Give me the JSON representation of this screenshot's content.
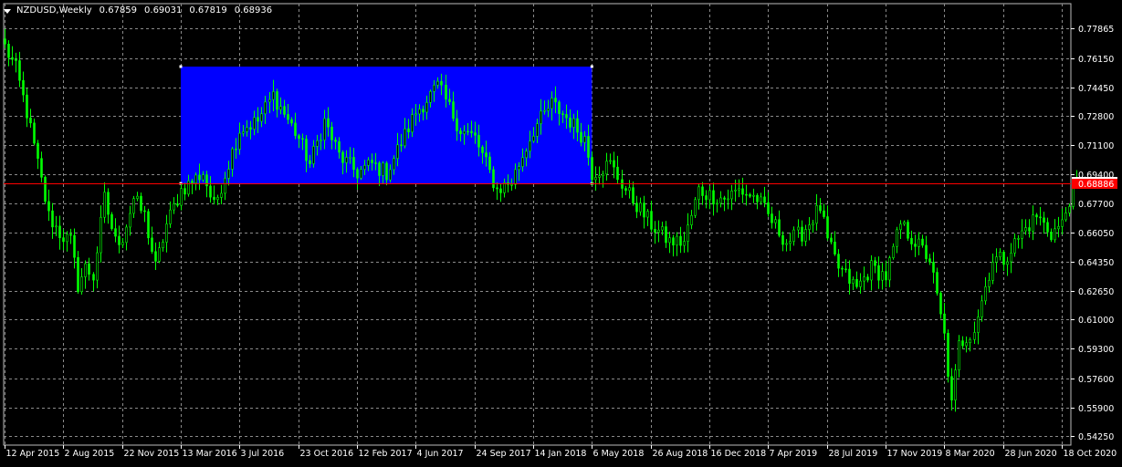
{
  "window": {
    "symbol_label": "NZDUSD,Weekly",
    "ohlc": [
      "0.67859",
      "0.69031",
      "0.67819",
      "0.68936"
    ]
  },
  "colors": {
    "background": "#000000",
    "grid": "#8a8a8a",
    "candle": "#00ff00",
    "rectangle": "#0000ff",
    "hline": "#ff0000",
    "price_tag_bg": "#ffffff",
    "hline_tag_bg": "#ff0000"
  },
  "chart_data": {
    "type": "candlestick",
    "title": "NZDUSD,Weekly",
    "ylim": [
      0.5425,
      0.7845
    ],
    "y_ticks": [
      "0.77865",
      "0.76150",
      "0.74450",
      "0.72800",
      "0.71100",
      "0.69400",
      "0.67700",
      "0.66050",
      "0.64350",
      "0.62650",
      "0.61000",
      "0.59300",
      "0.57600",
      "0.55900",
      "0.54250"
    ],
    "x_labels": [
      "12 Apr 2015",
      "2 Aug 2015",
      "22 Nov 2015",
      "13 Mar 2016",
      "3 Jul 2016",
      "23 Oct 2016",
      "12 Feb 2017",
      "4 Jun 2017",
      "24 Sep 2017",
      "14 Jan 2018",
      "6 May 2018",
      "26 Aug 2018",
      "16 Dec 2018",
      "7 Apr 2019",
      "28 Jul 2019",
      "17 Nov 2019",
      "8 Mar 2020",
      "28 Jun 2020",
      "18 Oct 2020"
    ],
    "current_price": "0.68936",
    "horizontal_line_price": "0.68886",
    "rectangle": {
      "from": "13 Mar 2016",
      "to": "6 May 2018",
      "top": 0.7565,
      "bottom": 0.6888
    },
    "path_anchors": [
      [
        "12 Apr 2015",
        0.768
      ],
      [
        "3 May 2015",
        0.755
      ],
      [
        "24 May 2015",
        0.73
      ],
      [
        "14 Jun 2015",
        0.7
      ],
      [
        "5 Jul 2015",
        0.67
      ],
      [
        "26 Jul 2015",
        0.66
      ],
      [
        "2 Aug 2015",
        0.658
      ],
      [
        "16 Aug 2015",
        0.655
      ],
      [
        "30 Aug 2015",
        0.63
      ],
      [
        "13 Sep 2015",
        0.64
      ],
      [
        "27 Sep 2015",
        0.635
      ],
      [
        "18 Oct 2015",
        0.68
      ],
      [
        "8 Nov 2015",
        0.655
      ],
      [
        "22 Nov 2015",
        0.658
      ],
      [
        "13 Dec 2015",
        0.68
      ],
      [
        "3 Jan 2016",
        0.67
      ],
      [
        "24 Jan 2016",
        0.64
      ],
      [
        "14 Feb 2016",
        0.665
      ],
      [
        "6 Mar 2016",
        0.68
      ],
      [
        "13 Mar 2016",
        0.685
      ],
      [
        "3 Apr 2016",
        0.69
      ],
      [
        "24 Apr 2016",
        0.695
      ],
      [
        "15 May 2016",
        0.675
      ],
      [
        "3 Jul 2016",
        0.72
      ],
      [
        "7 Aug 2016",
        0.725
      ],
      [
        "4 Sep 2016",
        0.74
      ],
      [
        "23 Oct 2016",
        0.715
      ],
      [
        "13 Nov 2016",
        0.7
      ],
      [
        "11 Dec 2016",
        0.725
      ],
      [
        "8 Jan 2017",
        0.705
      ],
      [
        "12 Feb 2017",
        0.695
      ],
      [
        "12 Mar 2017",
        0.7
      ],
      [
        "9 Apr 2017",
        0.695
      ],
      [
        "4 Jun 2017",
        0.73
      ],
      [
        "16 Jul 2017",
        0.745
      ],
      [
        "27 Aug 2017",
        0.72
      ],
      [
        "24 Sep 2017",
        0.715
      ],
      [
        "5 Nov 2017",
        0.685
      ],
      [
        "3 Dec 2017",
        0.69
      ],
      [
        "14 Jan 2018",
        0.72
      ],
      [
        "18 Feb 2018",
        0.735
      ],
      [
        "25 Mar 2018",
        0.725
      ],
      [
        "22 Apr 2018",
        0.715
      ],
      [
        "6 May 2018",
        0.695
      ],
      [
        "10 Jun 2018",
        0.7
      ],
      [
        "8 Jul 2018",
        0.685
      ],
      [
        "26 Aug 2018",
        0.665
      ],
      [
        "30 Sep 2018",
        0.655
      ],
      [
        "28 Oct 2018",
        0.655
      ],
      [
        "25 Nov 2018",
        0.685
      ],
      [
        "16 Dec 2018",
        0.682
      ],
      [
        "13 Jan 2019",
        0.68
      ],
      [
        "10 Feb 2019",
        0.685
      ],
      [
        "17 Mar 2019",
        0.68
      ],
      [
        "7 Apr 2019",
        0.67
      ],
      [
        "12 May 2019",
        0.655
      ],
      [
        "9 Jun 2019",
        0.66
      ],
      [
        "14 Jul 2019",
        0.675
      ],
      [
        "28 Jul 2019",
        0.655
      ],
      [
        "18 Aug 2019",
        0.64
      ],
      [
        "22 Sep 2019",
        0.628
      ],
      [
        "20 Oct 2019",
        0.64
      ],
      [
        "17 Nov 2019",
        0.635
      ],
      [
        "15 Dec 2019",
        0.665
      ],
      [
        "12 Jan 2020",
        0.655
      ],
      [
        "9 Feb 2020",
        0.645
      ],
      [
        "8 Mar 2020",
        0.6
      ],
      [
        "22 Mar 2020",
        0.56
      ],
      [
        "5 Apr 2020",
        0.595
      ],
      [
        "3 May 2020",
        0.605
      ],
      [
        "7 Jun 2020",
        0.645
      ],
      [
        "28 Jun 2020",
        0.645
      ],
      [
        "2 Aug 2020",
        0.66
      ],
      [
        "30 Aug 2020",
        0.67
      ],
      [
        "27 Sep 2020",
        0.66
      ],
      [
        "18 Oct 2020",
        0.665
      ],
      [
        "1 Nov 2020",
        0.68
      ],
      [
        "15 Nov 2020",
        0.6894
      ]
    ]
  }
}
